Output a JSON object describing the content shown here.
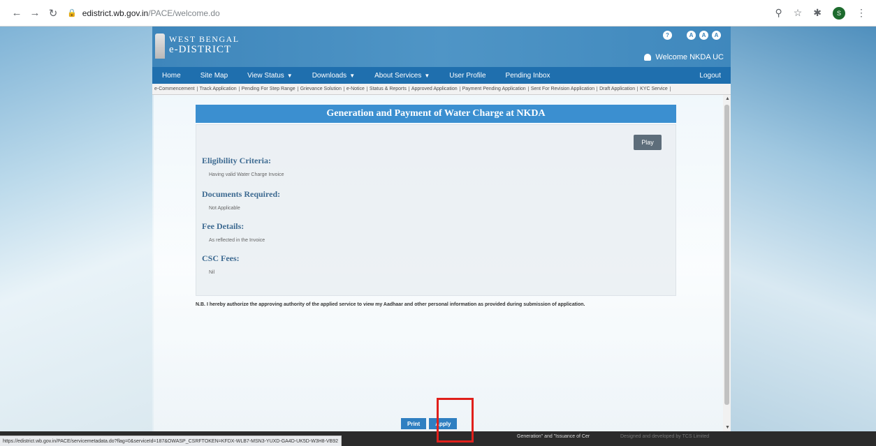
{
  "browser": {
    "url_domain": "edistrict.wb.gov.in",
    "url_path": "/PACE/welcome.do",
    "profile_initial": "S"
  },
  "header": {
    "brand_line1": "WEST BENGAL",
    "brand_line2": "e-DISTRICT",
    "welcome": "Welcome NKDA UC"
  },
  "nav": {
    "items": [
      {
        "label": "Home"
      },
      {
        "label": "Site Map"
      },
      {
        "label": "View Status",
        "dropdown": true
      },
      {
        "label": "Downloads",
        "dropdown": true
      },
      {
        "label": "About Services",
        "dropdown": true
      },
      {
        "label": "User Profile"
      },
      {
        "label": "Pending Inbox"
      }
    ],
    "logout": "Logout"
  },
  "subnav": {
    "items": [
      "e-Commencement",
      "Track Application",
      "Pending For Step Range",
      "Grievance Solution",
      "e-Notice",
      "Status & Reports",
      "Approved Application",
      "Payment Pending Application",
      "Sent For Revision Application",
      "Draft Application",
      "KYC Service"
    ]
  },
  "main": {
    "title": "Generation and Payment of Water Charge at NKDA",
    "play_label": "Play",
    "sections": [
      {
        "heading": "Eligibility Criteria:",
        "value": "Having valid Water Charge Invoice"
      },
      {
        "heading": "Documents Required:",
        "value": "Not Applicable"
      },
      {
        "heading": "Fee Details:",
        "value": "As reflected in the Invoice"
      },
      {
        "heading": "CSC Fees:",
        "value": "Nil"
      }
    ],
    "note": "N.B. I hereby authorize the approving authority of the applied service to view my Aadhaar and other personal information as provided during submission of application.",
    "print_label": "Print",
    "apply_label": "Apply"
  },
  "footer": {
    "status_url": "https://edistrict.wb.gov.in/PACE/servicemetadata.do?flag=0&serviceId=187&OWASP_CSRFTOKEN=KFDX-WLB7-MSN3-YUXD-GA4D-UK5D-W3H8-VB92",
    "text": "Generation\" and \"Issuance of Cer",
    "credit": "Designed and developed by TCS Limited"
  }
}
